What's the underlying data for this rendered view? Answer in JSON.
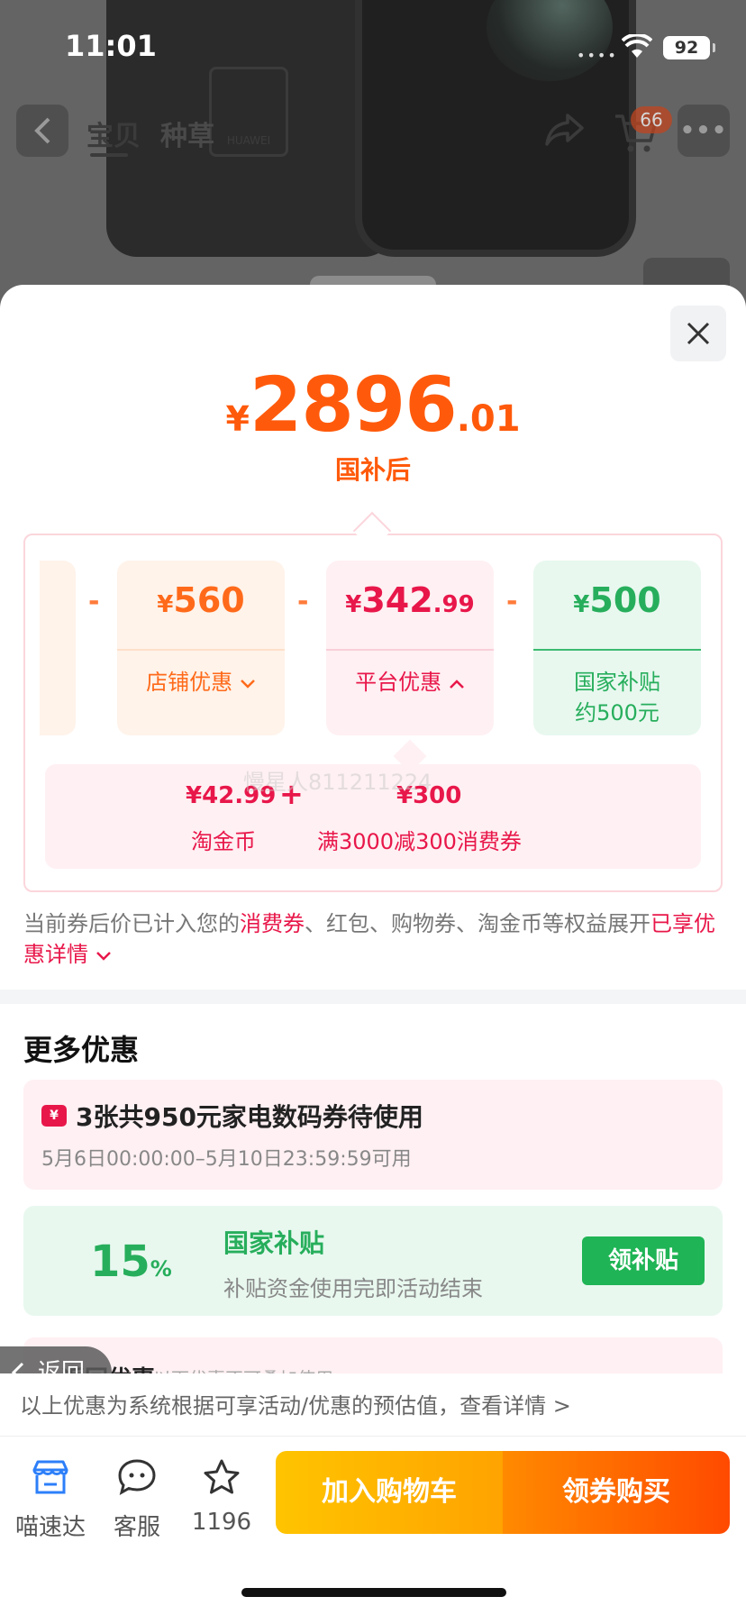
{
  "status_bar": {
    "time": "11:01",
    "battery": "92"
  },
  "nav": {
    "tab_baobei": "宝贝",
    "tab_zhongcao": "种草",
    "cart_count": "66"
  },
  "product_image": {
    "brand_text": "HUAWEI"
  },
  "price": {
    "currency": "¥",
    "integer": "2896",
    "decimal": ".01",
    "label": "国补后"
  },
  "breakdown": {
    "shop": {
      "currency": "¥",
      "amount": "560",
      "label": "店铺优惠"
    },
    "platform": {
      "currency": "¥",
      "amount": "342",
      "decimal": ".99",
      "label": "平台优惠"
    },
    "national": {
      "currency": "¥",
      "amount": "500",
      "label_line1": "国家补贴",
      "label_line2": "约500元"
    },
    "minus": "-",
    "platform_detail": {
      "coin_amount": "¥42.99",
      "coin_label": "淘金币",
      "plus": "+",
      "voucher_amount": "¥300",
      "voucher_label": "满3000减300消费券"
    },
    "watermark": "慢星人811211224"
  },
  "note": {
    "part1": "当前券后价已计入您的",
    "highlight1": "消费券",
    "part2": "、红包、购物券、淘金币等权益展开",
    "highlight2": "已享优惠详情"
  },
  "more_offers": {
    "title": "更多优惠",
    "coupon": {
      "icon_text": "¥",
      "title": "3张共950元家电数码券待使用",
      "time": "5月6日00:00:00–5月10日23:59:59可用"
    },
    "subsidy": {
      "percent": "15",
      "percent_sign": "%",
      "title": "国家补贴",
      "desc": "补贴资金使用完即活动结束",
      "button": "领补贴"
    },
    "partial": {
      "title": "返回优惠",
      "sub": "以下优惠不可叠加使用"
    }
  },
  "return_button": "返回",
  "footer_note": "以上优惠为系统根据可享活动/优惠的预估值，查看详情 >",
  "bottom_bar": {
    "store": "喵速达",
    "service": "客服",
    "favorites": "1196",
    "add_to_cart": "加入购物车",
    "buy": "领券购买"
  },
  "colors": {
    "accent": "#ff5a0b",
    "platform_red": "#e8174a",
    "green": "#27ae5c"
  }
}
